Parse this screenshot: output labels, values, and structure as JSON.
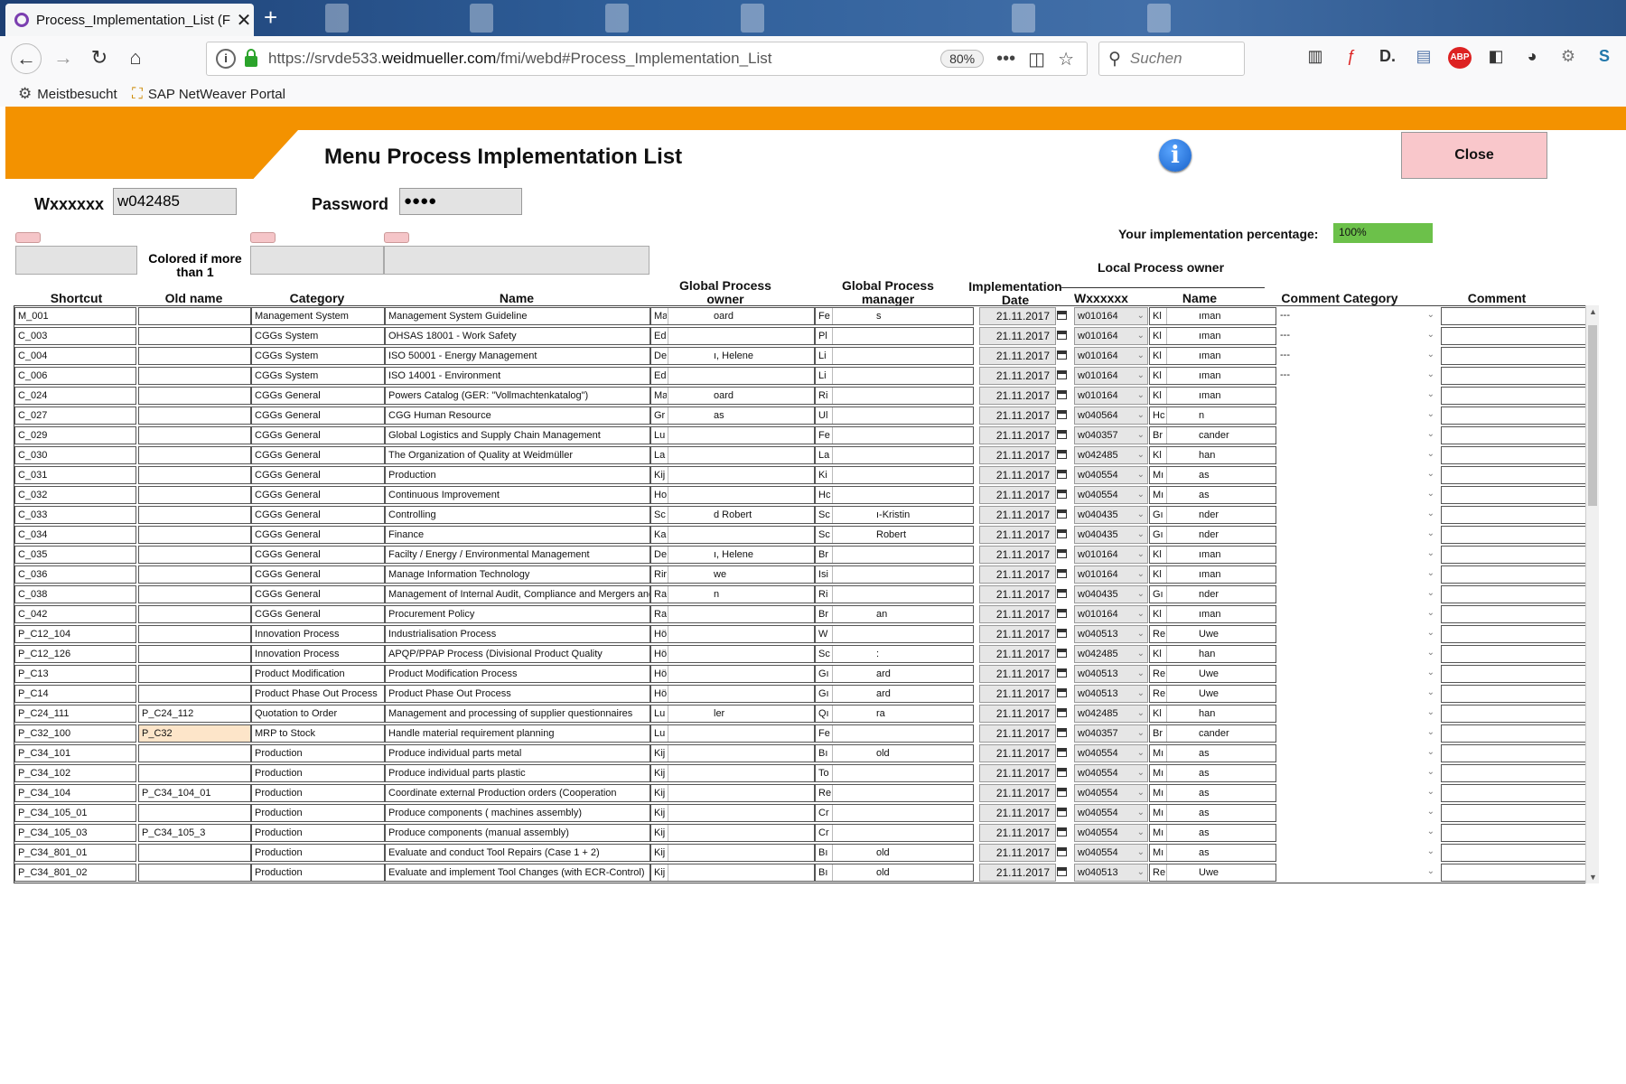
{
  "browser": {
    "tab_title": "Process_Implementation_List (F",
    "url_host": "https://srvde533.",
    "url_domain": "weidmueller.com",
    "url_path": "/fmi/webd#Process_Implementation_List",
    "zoom": "80%",
    "search_placeholder": "Suchen",
    "bookmarks": [
      "Meistbesucht",
      "SAP NetWeaver Portal"
    ]
  },
  "app": {
    "title": "Menu Process Implementation List",
    "close_label": "Close",
    "user_label": "Wxxxxxx",
    "user_value": "w042485",
    "password_label": "Password",
    "password_value": "●●●●",
    "percentage_label": "Your implementation percentage:",
    "percentage_value": "100%",
    "percentage_fraction": 1.0,
    "colored_note": "Colored if more than 1"
  },
  "table": {
    "headers": {
      "shortcut": "Shortcut",
      "old_name": "Old name",
      "category": "Category",
      "name": "Name",
      "gpo": "Global Process owner",
      "gpm": "Global Process manager",
      "impl_date": "Implementation Date",
      "lpo_group": "Local Process owner",
      "wxxxxxx": "Wxxxxxx",
      "lpo_name": "Name",
      "comment_category": "Comment Category",
      "comment": "Comment"
    },
    "rows": [
      {
        "shortcut": "M_001",
        "old": "",
        "category": "Management System",
        "name": "Management System Guideline",
        "gpo_a": "Ma",
        "gpo_b": "oard",
        "gpm_a": "Fe",
        "gpm_b": "s",
        "date": "21.11.2017",
        "w": "w010164",
        "ln_a": "Kl",
        "ln_b": "ıman",
        "cc": "---"
      },
      {
        "shortcut": "C_003",
        "old": "",
        "category": "CGGs System",
        "name": "OHSAS 18001 - Work Safety",
        "gpo_a": "Ed",
        "gpo_b": "",
        "gpm_a": "Pl",
        "gpm_b": "",
        "date": "21.11.2017",
        "w": "w010164",
        "ln_a": "Kl",
        "ln_b": "ıman",
        "cc": "---"
      },
      {
        "shortcut": "C_004",
        "old": "",
        "category": "CGGs System",
        "name": "ISO 50001 - Energy Management",
        "gpo_a": "De",
        "gpo_b": "ı, Helene",
        "gpm_a": "Li",
        "gpm_b": "",
        "date": "21.11.2017",
        "w": "w010164",
        "ln_a": "Kl",
        "ln_b": "ıman",
        "cc": "---"
      },
      {
        "shortcut": "C_006",
        "old": "",
        "category": "CGGs System",
        "name": "ISO 14001 - Environment",
        "gpo_a": "Ed",
        "gpo_b": "",
        "gpm_a": "Li",
        "gpm_b": "",
        "date": "21.11.2017",
        "w": "w010164",
        "ln_a": "Kl",
        "ln_b": "ıman",
        "cc": "---"
      },
      {
        "shortcut": "C_024",
        "old": "",
        "category": "CGGs General",
        "name": "Powers Catalog (GER: \"Vollmachtenkatalog\")",
        "gpo_a": "Ma",
        "gpo_b": "oard",
        "gpm_a": "Ri",
        "gpm_b": "",
        "date": "21.11.2017",
        "w": "w010164",
        "ln_a": "Kl",
        "ln_b": "ıman",
        "cc": ""
      },
      {
        "shortcut": "C_027",
        "old": "",
        "category": "CGGs General",
        "name": "CGG Human Resource",
        "gpo_a": "Gr",
        "gpo_b": "as",
        "gpm_a": "Ul",
        "gpm_b": "",
        "date": "21.11.2017",
        "w": "w040564",
        "ln_a": "Hc",
        "ln_b": "n",
        "cc": ""
      },
      {
        "shortcut": "C_029",
        "old": "",
        "category": "CGGs General",
        "name": "Global Logistics and Supply Chain Management",
        "gpo_a": "Lu",
        "gpo_b": "",
        "gpm_a": "Fe",
        "gpm_b": "",
        "date": "21.11.2017",
        "w": "w040357",
        "ln_a": "Br",
        "ln_b": "cander",
        "cc": ""
      },
      {
        "shortcut": "C_030",
        "old": "",
        "category": "CGGs General",
        "name": "The Organization of Quality at Weidmüller",
        "gpo_a": "La",
        "gpo_b": "",
        "gpm_a": "La",
        "gpm_b": "",
        "date": "21.11.2017",
        "w": "w042485",
        "ln_a": "Kl",
        "ln_b": "han",
        "cc": ""
      },
      {
        "shortcut": "C_031",
        "old": "",
        "category": "CGGs General",
        "name": "Production",
        "gpo_a": "Kij",
        "gpo_b": "",
        "gpm_a": "Ki",
        "gpm_b": "",
        "date": "21.11.2017",
        "w": "w040554",
        "ln_a": "Mı",
        "ln_b": "as",
        "cc": ""
      },
      {
        "shortcut": "C_032",
        "old": "",
        "category": "CGGs General",
        "name": "Continuous Improvement",
        "gpo_a": "Ho",
        "gpo_b": "",
        "gpm_a": "Hc",
        "gpm_b": "",
        "date": "21.11.2017",
        "w": "w040554",
        "ln_a": "Mı",
        "ln_b": "as",
        "cc": ""
      },
      {
        "shortcut": "C_033",
        "old": "",
        "category": "CGGs General",
        "name": "Controlling",
        "gpo_a": "Sc",
        "gpo_b": "d Robert",
        "gpm_a": "Sc",
        "gpm_b": "ı-Kristin",
        "date": "21.11.2017",
        "w": "w040435",
        "ln_a": "Gı",
        "ln_b": "nder",
        "cc": ""
      },
      {
        "shortcut": "C_034",
        "old": "",
        "category": "CGGs General",
        "name": "Finance",
        "gpo_a": "Ka",
        "gpo_b": "",
        "gpm_a": "Sc",
        "gpm_b": "Robert",
        "date": "21.11.2017",
        "w": "w040435",
        "ln_a": "Gı",
        "ln_b": "nder",
        "cc": ""
      },
      {
        "shortcut": "C_035",
        "old": "",
        "category": "CGGs General",
        "name": "Facilty / Energy / Environmental Management",
        "gpo_a": "De",
        "gpo_b": "ı, Helene",
        "gpm_a": "Br",
        "gpm_b": "",
        "date": "21.11.2017",
        "w": "w010164",
        "ln_a": "Kl",
        "ln_b": "ıman",
        "cc": ""
      },
      {
        "shortcut": "C_036",
        "old": "",
        "category": "CGGs General",
        "name": "Manage Information Technology",
        "gpo_a": "Rir",
        "gpo_b": "we",
        "gpm_a": "Isi",
        "gpm_b": "",
        "date": "21.11.2017",
        "w": "w010164",
        "ln_a": "Kl",
        "ln_b": "ıman",
        "cc": ""
      },
      {
        "shortcut": "C_038",
        "old": "",
        "category": "CGGs General",
        "name": "Management of Internal Audit, Compliance and Mergers and",
        "gpo_a": "Ra",
        "gpo_b": "n",
        "gpm_a": "Ri",
        "gpm_b": "",
        "date": "21.11.2017",
        "w": "w040435",
        "ln_a": "Gı",
        "ln_b": "nder",
        "cc": ""
      },
      {
        "shortcut": "C_042",
        "old": "",
        "category": "CGGs General",
        "name": "Procurement Policy",
        "gpo_a": "Ra",
        "gpo_b": "",
        "gpm_a": "Br",
        "gpm_b": "an",
        "date": "21.11.2017",
        "w": "w010164",
        "ln_a": "Kl",
        "ln_b": "ıman",
        "cc": ""
      },
      {
        "shortcut": "P_C12_104",
        "old": "",
        "category": "Innovation Process",
        "name": "Industrialisation Process",
        "gpo_a": "Hö",
        "gpo_b": "",
        "gpm_a": "W",
        "gpm_b": "",
        "date": "21.11.2017",
        "w": "w040513",
        "ln_a": "Re",
        "ln_b": "Uwe",
        "cc": ""
      },
      {
        "shortcut": "P_C12_126",
        "old": "",
        "category": "Innovation Process",
        "name": "APQP/PPAP Process (Divisional Product Quality",
        "gpo_a": "Hö",
        "gpo_b": "",
        "gpm_a": "Sc",
        "gpm_b": ":",
        "date": "21.11.2017",
        "w": "w042485",
        "ln_a": "Kl",
        "ln_b": "han",
        "cc": ""
      },
      {
        "shortcut": "P_C13",
        "old": "",
        "category": "Product Modification",
        "name": "Product Modification Process",
        "gpo_a": "Hö",
        "gpo_b": "",
        "gpm_a": "Gı",
        "gpm_b": "ard",
        "date": "21.11.2017",
        "w": "w040513",
        "ln_a": "Re",
        "ln_b": "Uwe",
        "cc": ""
      },
      {
        "shortcut": "P_C14",
        "old": "",
        "category": "Product Phase Out Process",
        "name": "Product Phase Out Process",
        "gpo_a": "Hö",
        "gpo_b": "",
        "gpm_a": "Gı",
        "gpm_b": "ard",
        "date": "21.11.2017",
        "w": "w040513",
        "ln_a": "Re",
        "ln_b": "Uwe",
        "cc": ""
      },
      {
        "shortcut": "P_C24_111",
        "old": "P_C24_112",
        "category": "Quotation to Order",
        "name": "Management and processing of supplier questionnaires",
        "gpo_a": "Lu",
        "gpo_b": "ler",
        "gpm_a": "Qı",
        "gpm_b": "ra",
        "date": "21.11.2017",
        "w": "w042485",
        "ln_a": "Kl",
        "ln_b": "han",
        "cc": ""
      },
      {
        "shortcut": "P_C32_100",
        "old": "P_C32",
        "category": "MRP to Stock",
        "name": "Handle material requirement planning",
        "gpo_a": "Lu",
        "gpo_b": "",
        "gpm_a": "Fe",
        "gpm_b": "",
        "date": "21.11.2017",
        "w": "w040357",
        "ln_a": "Br",
        "ln_b": "cander",
        "cc": ""
      },
      {
        "shortcut": "P_C34_101",
        "old": "",
        "category": "Production",
        "name": "Produce individual parts metal",
        "gpo_a": "Kij",
        "gpo_b": "",
        "gpm_a": "Bı",
        "gpm_b": "old",
        "date": "21.11.2017",
        "w": "w040554",
        "ln_a": "Mı",
        "ln_b": "as",
        "cc": ""
      },
      {
        "shortcut": "P_C34_102",
        "old": "",
        "category": "Production",
        "name": "Produce individual parts plastic",
        "gpo_a": "Kij",
        "gpo_b": "",
        "gpm_a": "To",
        "gpm_b": "",
        "date": "21.11.2017",
        "w": "w040554",
        "ln_a": "Mı",
        "ln_b": "as",
        "cc": ""
      },
      {
        "shortcut": "P_C34_104",
        "old": "P_C34_104_01",
        "category": "Production",
        "name": "Coordinate external Production orders (Cooperation",
        "gpo_a": "Kij",
        "gpo_b": "",
        "gpm_a": "Re",
        "gpm_b": "",
        "date": "21.11.2017",
        "w": "w040554",
        "ln_a": "Mı",
        "ln_b": "as",
        "cc": ""
      },
      {
        "shortcut": "P_C34_105_01",
        "old": "",
        "category": "Production",
        "name": "Produce components ( machines assembly)",
        "gpo_a": "Kij",
        "gpo_b": "",
        "gpm_a": "Cr",
        "gpm_b": "",
        "date": "21.11.2017",
        "w": "w040554",
        "ln_a": "Mı",
        "ln_b": "as",
        "cc": ""
      },
      {
        "shortcut": "P_C34_105_03",
        "old": "P_C34_105_3",
        "category": "Production",
        "name": "Produce components (manual assembly)",
        "gpo_a": "Kij",
        "gpo_b": "",
        "gpm_a": "Cr",
        "gpm_b": "",
        "date": "21.11.2017",
        "w": "w040554",
        "ln_a": "Mı",
        "ln_b": "as",
        "cc": ""
      },
      {
        "shortcut": "P_C34_801_01",
        "old": "",
        "category": "Production",
        "name": "Evaluate and conduct Tool Repairs  (Case 1 + 2)",
        "gpo_a": "Kij",
        "gpo_b": "",
        "gpm_a": "Bı",
        "gpm_b": "old",
        "date": "21.11.2017",
        "w": "w040554",
        "ln_a": "Mı",
        "ln_b": "as",
        "cc": ""
      },
      {
        "shortcut": "P_C34_801_02",
        "old": "",
        "category": "Production",
        "name": "Evaluate and implement Tool Changes (with ECR-Control)",
        "gpo_a": "Kij",
        "gpo_b": "",
        "gpm_a": "Bı",
        "gpm_b": "old",
        "date": "21.11.2017",
        "w": "w040513",
        "ln_a": "Re",
        "ln_b": "Uwe",
        "cc": ""
      }
    ]
  }
}
